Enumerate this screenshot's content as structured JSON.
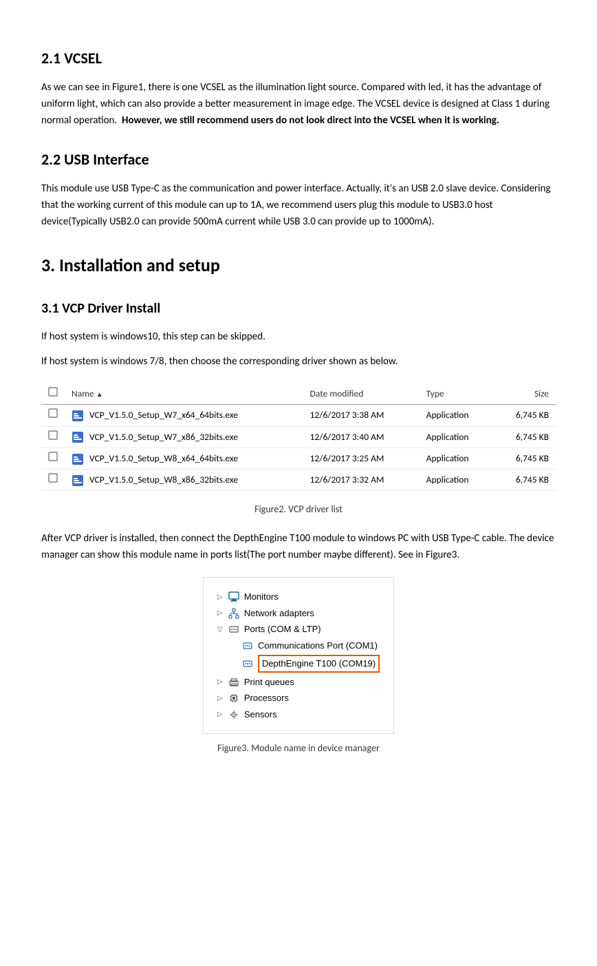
{
  "sections": {
    "vcsel": {
      "heading": "2.1 VCSEL",
      "paragraph": "As we can see in Figure1, there is one VCSEL as the illumination light source. Compared with led, it has the advantage of uniform light, which can also provide a better measurement in image edge. The VCSEL device is designed at Class 1 during normal operation.",
      "bold_text": "However, we still recommend users do not look direct into the VCSEL when it is working."
    },
    "usb": {
      "heading": "2.2 USB Interface",
      "paragraph": "This module use USB Type-C as the communication and power interface. Actually, it's an USB 2.0 slave device. Considering that the working current of this module can up to 1A, we recommend users plug this module to USB3.0 host device(Typically USB2.0 can provide 500mA current while USB 3.0 can provide up to 1000mA)."
    },
    "installation": {
      "heading": "3. Installation and setup"
    },
    "vcp": {
      "heading": "3.1 VCP Driver Install",
      "para1": "If host system is windows10, this step can be skipped.",
      "para2": "If host system is windows 7/8, then choose the corresponding driver shown as below."
    },
    "figure2": {
      "caption": "Figure2. VCP driver list"
    },
    "after_vcp": {
      "paragraph": "After VCP driver is installed, then connect the DepthEngine T100 module to windows PC with USB Type-C cable. The device manager can show this module name in ports list(The port number maybe different). See in Figure3."
    },
    "figure3": {
      "caption": "Figure3. Module name in device manager"
    }
  },
  "file_table": {
    "headers": {
      "checkbox": "",
      "name": "Name",
      "sort_indicator": "▲",
      "date_modified": "Date modified",
      "type": "Type",
      "size": "Size"
    },
    "rows": [
      {
        "name": "VCP_V1.5.0_Setup_W7_x64_64bits.exe",
        "date": "12/6/2017 3:38 AM",
        "type": "Application",
        "size": "6,745 KB"
      },
      {
        "name": "VCP_V1.5.0_Setup_W7_x86_32bits.exe",
        "date": "12/6/2017 3:40 AM",
        "type": "Application",
        "size": "6,745 KB"
      },
      {
        "name": "VCP_V1.5.0_Setup_W8_x64_64bits.exe",
        "date": "12/6/2017 3:25 AM",
        "type": "Application",
        "size": "6,745 KB"
      },
      {
        "name": "VCP_V1.5.0_Setup_W8_x86_32bits.exe",
        "date": "12/6/2017 3:32 AM",
        "type": "Application",
        "size": "6,745 KB"
      }
    ]
  },
  "device_manager": {
    "items": [
      {
        "indent": 0,
        "arrow": "▷",
        "icon": "monitor",
        "label": "Monitors"
      },
      {
        "indent": 0,
        "arrow": "▷",
        "icon": "network",
        "label": "Network adapters"
      },
      {
        "indent": 0,
        "arrow": "▽",
        "icon": "ports",
        "label": "Ports (COM & LTP)"
      },
      {
        "indent": 1,
        "arrow": "",
        "icon": "com",
        "label": "Communications Port (COM1)"
      },
      {
        "indent": 1,
        "arrow": "",
        "icon": "com",
        "label": "DepthEngine T100 (COM19)",
        "highlighted": true
      },
      {
        "indent": 0,
        "arrow": "▷",
        "icon": "printer",
        "label": "Print queues"
      },
      {
        "indent": 0,
        "arrow": "▷",
        "icon": "processor",
        "label": "Processors"
      },
      {
        "indent": 0,
        "arrow": "▷",
        "icon": "sensor",
        "label": "Sensors"
      }
    ]
  }
}
